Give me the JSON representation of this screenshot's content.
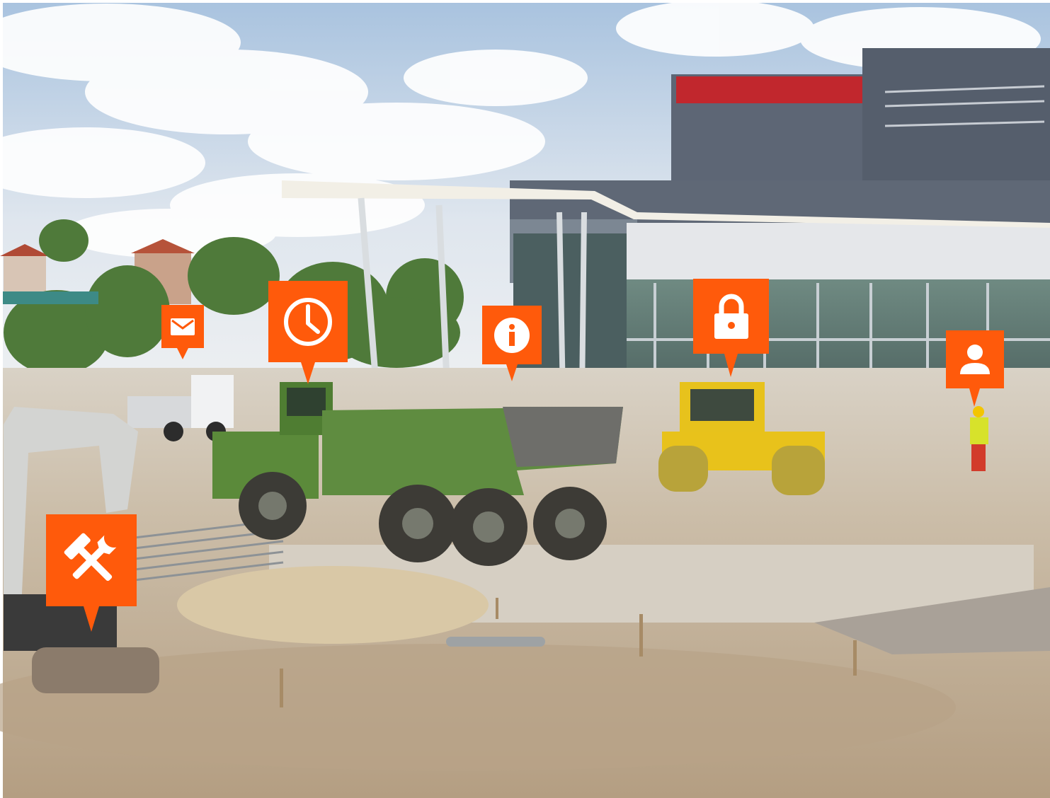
{
  "colors": {
    "marker": "#ff5a0b",
    "sky_top": "#aac4e0",
    "sky_bottom": "#eef1f4",
    "ground": "#c9b9a2",
    "building": "#5b6473",
    "dump_truck": "#5d8a3c",
    "roller": "#e8c21a"
  },
  "markers": [
    {
      "name": "mail-marker",
      "icon": "envelope-icon"
    },
    {
      "name": "clock-marker",
      "icon": "clock-icon"
    },
    {
      "name": "info-marker",
      "icon": "info-icon"
    },
    {
      "name": "lock-marker",
      "icon": "lock-icon"
    },
    {
      "name": "user-marker",
      "icon": "user-icon"
    },
    {
      "name": "tools-marker",
      "icon": "hammer-wrench-icon"
    }
  ]
}
